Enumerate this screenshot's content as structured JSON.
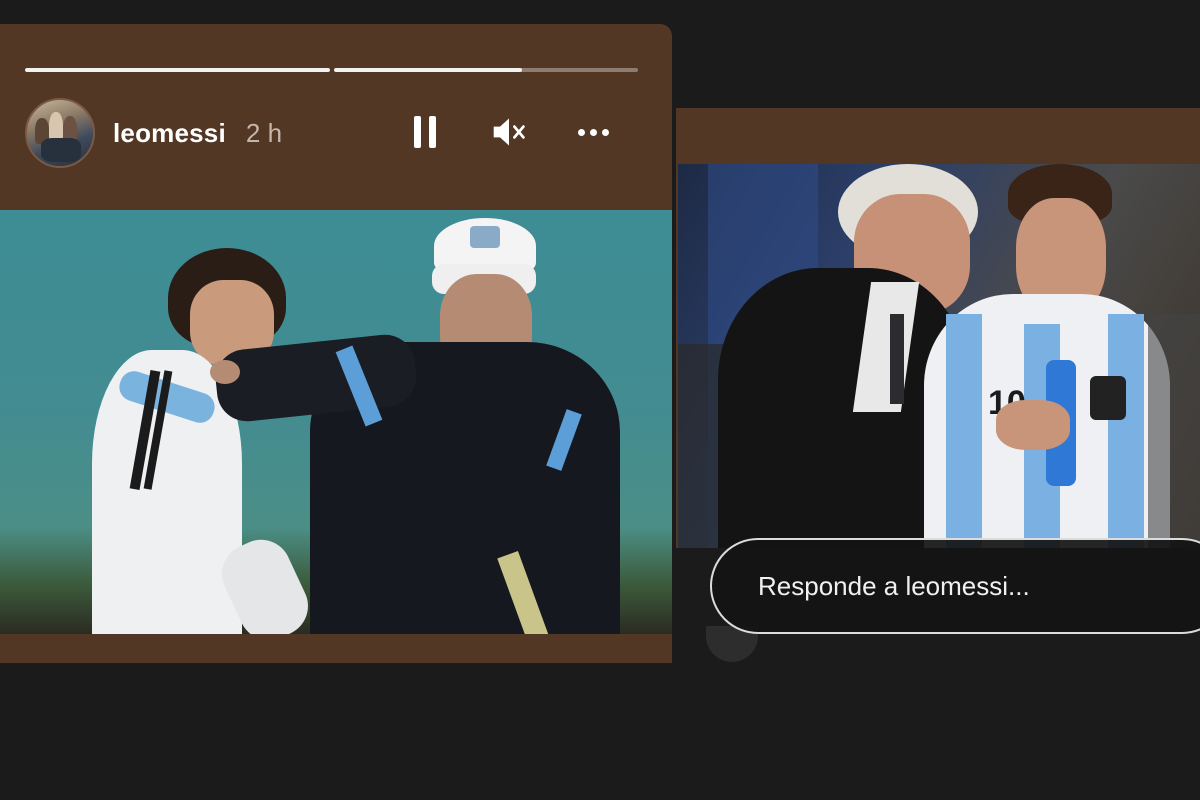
{
  "story": {
    "username": "leomessi",
    "timestamp": "2 h",
    "progress": [
      1.0,
      0.62
    ],
    "controls": {
      "pause_icon": "pause-icon",
      "mute_icon": "speaker-muted-icon",
      "more_icon": "more-horizontal-icon"
    }
  },
  "reply": {
    "placeholder": "Responde a leomessi..."
  },
  "colors": {
    "page_bg": "#1b1b1b",
    "story_bg": "#523724",
    "progress_fill": "#f2f2f2"
  }
}
